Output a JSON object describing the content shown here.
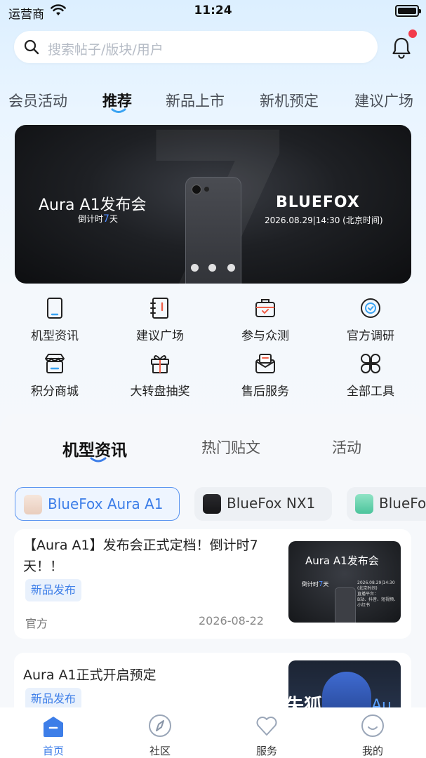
{
  "status_bar": {
    "carrier": "运营商",
    "time": "11:24"
  },
  "search": {
    "placeholder": "搜索帖子/版块/用户"
  },
  "colors": {
    "accent": "#3d7ee8",
    "badge": "#f23b4b"
  },
  "tabs": [
    {
      "label": "会员活动",
      "active": false
    },
    {
      "label": "推荐",
      "active": true
    },
    {
      "label": "新品上市",
      "active": false
    },
    {
      "label": "新机预定",
      "active": false
    },
    {
      "label": "建议广场",
      "active": false
    }
  ],
  "banner": {
    "title": "Aura A1发布会",
    "countdown_prefix": "倒计时",
    "countdown_num": "7",
    "countdown_suffix": "天",
    "brand": "BLUEFOX",
    "datetime": "2026.08.29|14:30 (北京时间)",
    "page_count": 3
  },
  "tools": [
    {
      "label": "机型资讯",
      "icon": "tablet-icon"
    },
    {
      "label": "建议广场",
      "icon": "notebook-icon"
    },
    {
      "label": "参与众测",
      "icon": "briefcase-check-icon"
    },
    {
      "label": "官方调研",
      "icon": "badge-icon"
    },
    {
      "label": "积分商城",
      "icon": "store-icon"
    },
    {
      "label": "大转盘抽奖",
      "icon": "gift-icon"
    },
    {
      "label": "售后服务",
      "icon": "mail-service-icon"
    },
    {
      "label": "全部工具",
      "icon": "grid-clover-icon"
    }
  ],
  "sub_tabs": [
    {
      "label": "机型资讯",
      "active": true
    },
    {
      "label": "热门贴文",
      "active": false
    },
    {
      "label": "活动",
      "active": false
    }
  ],
  "chips": [
    {
      "label": "BlueFox Aura A1",
      "active": true
    },
    {
      "label": "BlueFox NX1",
      "active": false
    },
    {
      "label": "BlueFo",
      "active": false
    }
  ],
  "posts": [
    {
      "title": "【Aura A1】发布会正式定档！倒计时7天！！",
      "tag": "新品发布",
      "author": "官方",
      "date": "2026-08-22",
      "thumb": {
        "title": "Aura A1发布会",
        "count_prefix": "倒计时",
        "count_num": "7",
        "count_suffix": "天",
        "meta_date": "2026.08.29|14:30",
        "meta_tz": "(北京时间)",
        "meta_platform": "直播平台：",
        "meta_channels": "B站、抖音、短视频、小红书"
      }
    },
    {
      "title": "Aura A1正式开启预定",
      "tag": "新品发布",
      "thumb": {
        "big": "失狐",
        "right": "Au"
      }
    }
  ],
  "tabbar": [
    {
      "label": "首页",
      "active": true
    },
    {
      "label": "社区",
      "active": false
    },
    {
      "label": "服务",
      "active": false
    },
    {
      "label": "我的",
      "active": false
    }
  ]
}
